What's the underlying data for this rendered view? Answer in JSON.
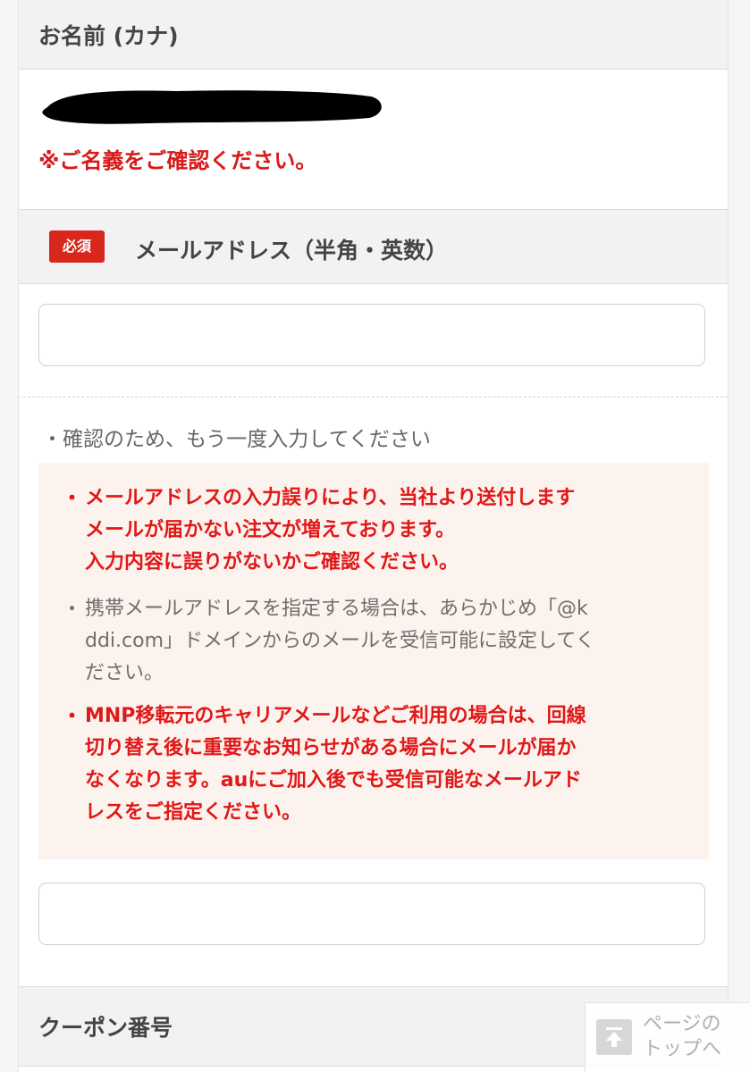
{
  "kana_section": {
    "header": "お名前 (カナ)",
    "note": "※ご名義をご確認ください。"
  },
  "email_section": {
    "required_badge": "必須",
    "header": "メールアドレス（半角・英数）",
    "email_value": "",
    "confirm_label": "・確認のため、もう一度入力してください",
    "confirm_value": ""
  },
  "notices": [
    {
      "bullet": "・",
      "lines": [
        "メールアドレスの入力誤りにより、当社より送付します",
        "メールが届かない注文が増えております。",
        "入力内容に誤りがないかご確認ください。"
      ],
      "color": "#e01818"
    },
    {
      "bullet": "・",
      "lines": [
        "携帯メールアドレスを指定する場合は、あらかじめ「@k",
        "ddi.com」ドメインからのメールを受信可能に設定してく",
        "ださい。"
      ],
      "color": "#6e6e6e"
    },
    {
      "bullet": "・",
      "lines": [
        "MNP移転元のキャリアメールなどご利用の場合は、回線",
        "切り替え後に重要なお知らせがある場合にメールが届か",
        "なくなります。auにご加入後でも受信可能なメールアド",
        "レスをご指定ください。"
      ],
      "color": "#e01818"
    }
  ],
  "coupon_section": {
    "header": "クーポン番号"
  },
  "page_top": {
    "label_line1": "ページの",
    "label_line2": "トップへ",
    "icon": "arrow-up-to-top-icon"
  },
  "colors": {
    "accent_red": "#e01818",
    "badge_red": "#d8271d",
    "notice_bg": "#fdf3ee",
    "header_bg": "#f2f2f2"
  }
}
